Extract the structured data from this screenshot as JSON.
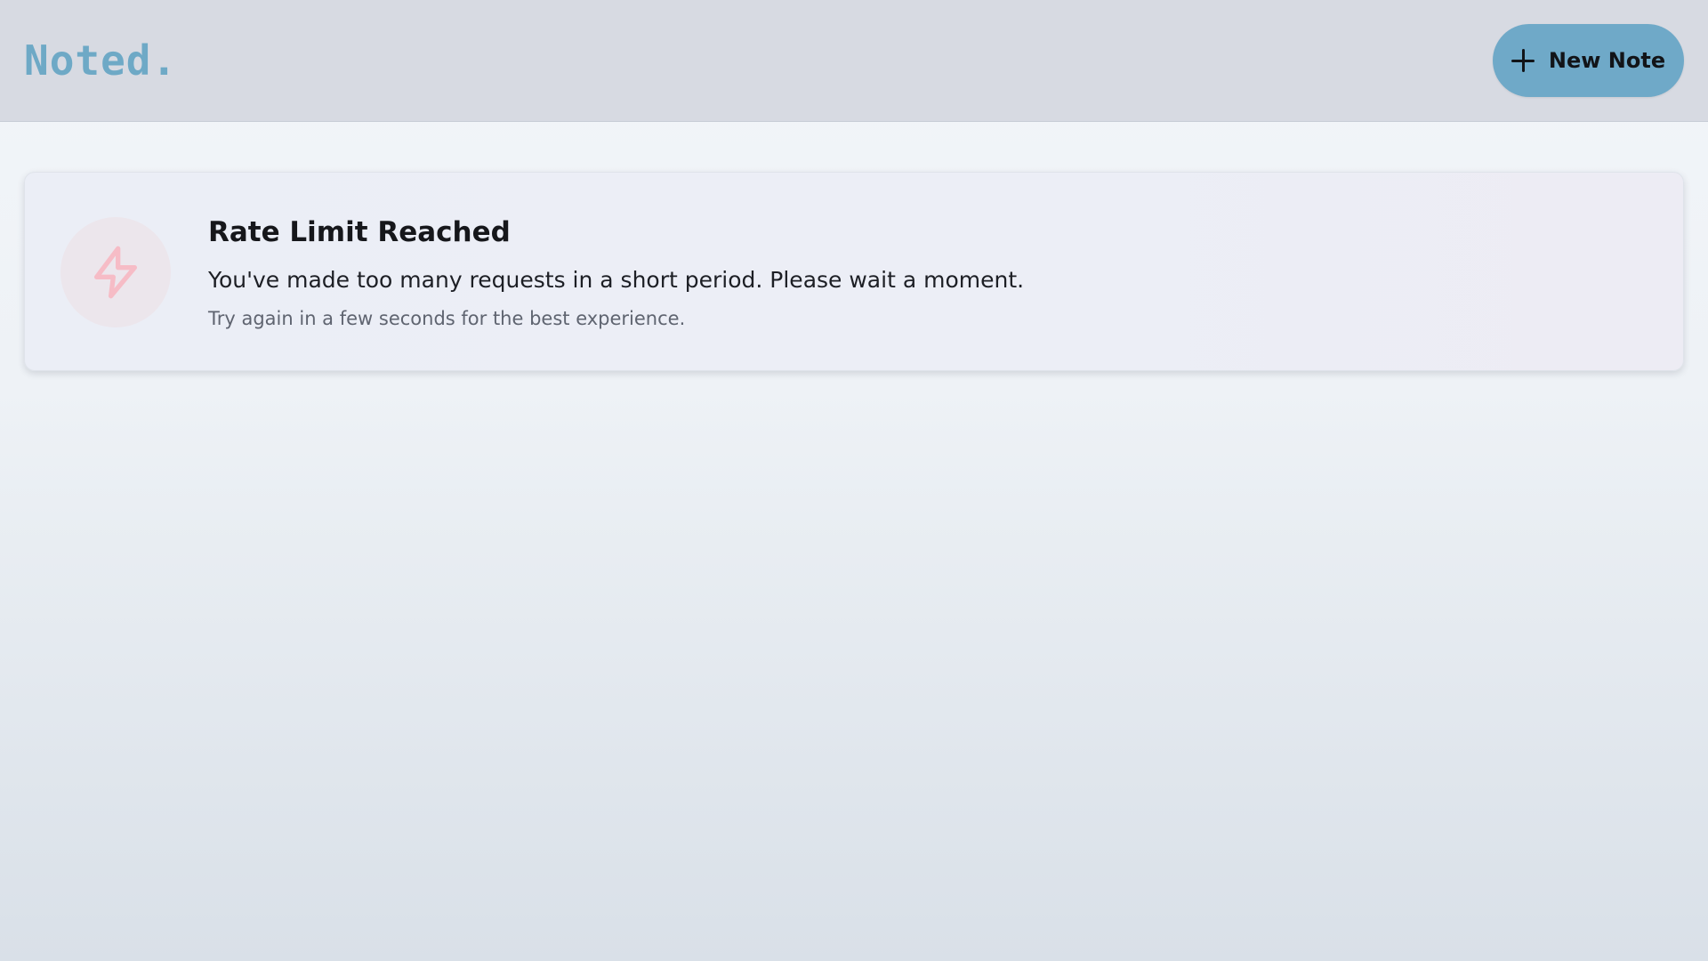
{
  "header": {
    "logo_text": "Noted.",
    "new_note_label": "New Note",
    "new_note_icon": "plus-icon"
  },
  "alert": {
    "icon": "lightning-bolt-icon",
    "title": "Rate Limit Reached",
    "message": "You've made too many requests in a short period. Please wait a moment.",
    "hint": "Try again in a few seconds for the best experience."
  },
  "colors": {
    "accent": "#6fa9c8",
    "logo": "#6ea9c6",
    "header_bg": "#d7dae2",
    "alert_icon": "#f7b9c4"
  }
}
